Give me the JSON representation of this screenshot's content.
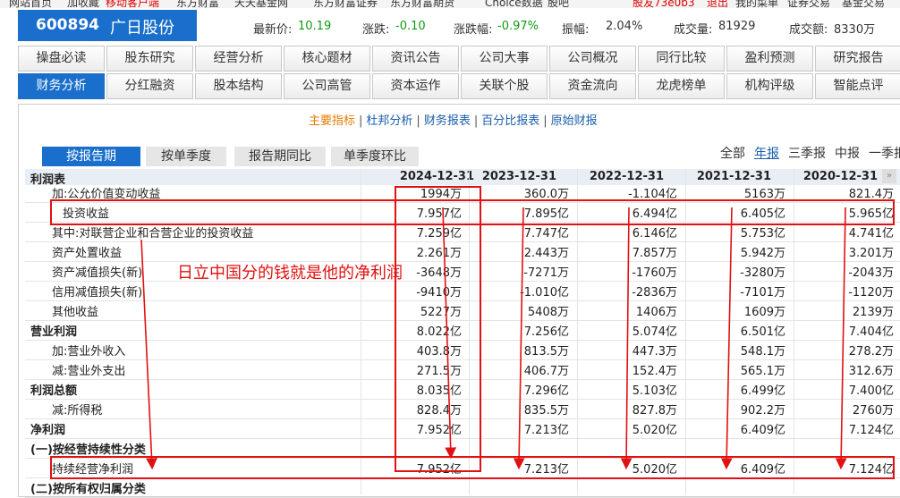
{
  "top_nav": {
    "items": [
      {
        "label": "网站首页",
        "red": false
      },
      {
        "label": "加收藏",
        "red": false
      },
      {
        "label": "移动客户端",
        "red": true
      },
      {
        "label": "东方财富",
        "red": false
      },
      {
        "label": "天天基金网",
        "red": false
      },
      {
        "label": "东方财富证券",
        "red": false
      },
      {
        "label": "东方财富期货",
        "red": false
      },
      {
        "label": "Choice数据",
        "red": false
      },
      {
        "label": "股吧",
        "red": false
      },
      {
        "label": "股友73e0b3",
        "red": true
      },
      {
        "label": "退出",
        "red": true
      },
      {
        "label": "我的菜单",
        "red": false
      },
      {
        "label": "证券交易",
        "red": false
      },
      {
        "label": "基金交易",
        "red": false
      }
    ]
  },
  "stock": {
    "code": "600894",
    "name": "广日股份"
  },
  "quote": {
    "price_label": "最新价:",
    "price": "10.19",
    "change_label": "涨跌:",
    "change": "-0.10",
    "change_pct_label": "涨跌幅:",
    "change_pct": "-0.97%",
    "amplitude_label": "振幅:",
    "amplitude": "2.04%",
    "volume_label": "成交量:",
    "volume": "81929",
    "turnover_label": "成交额:",
    "turnover": "8330万"
  },
  "tabs_row1": [
    "操盘必读",
    "股东研究",
    "经营分析",
    "核心题材",
    "资讯公告",
    "公司大事",
    "公司概况",
    "同行比较",
    "盈利预测",
    "研究报告"
  ],
  "tabs_row2": [
    "财务分析",
    "分红融资",
    "股本结构",
    "公司高管",
    "资本运作",
    "关联个股",
    "资金流向",
    "龙虎榜单",
    "机构评级",
    "智能点评"
  ],
  "active_tab": "财务分析",
  "sub_links": [
    "主要指标",
    "杜邦分析",
    "财务报表",
    "百分比报表",
    "原始财报"
  ],
  "active_sub_link": "主要指标",
  "period_tabs": [
    "按报告期",
    "按单季度",
    "报告期同比",
    "单季度环比"
  ],
  "period_filters": [
    "全部",
    "年报",
    "三季报",
    "中报",
    "一季报"
  ],
  "active_filter": "年报",
  "table": {
    "title": "利润表",
    "columns": [
      "2024-12-31",
      "2023-12-31",
      "2022-12-31",
      "2021-12-31",
      "2020-12-31"
    ],
    "rows": [
      {
        "label": "加:公允价值变动收益",
        "indent": 2,
        "bold": false,
        "values": [
          "1994万",
          "360.0万",
          "-1.104亿",
          "5163万",
          "821.4万"
        ]
      },
      {
        "label": "投资收益",
        "indent": 3,
        "bold": false,
        "values": [
          "7.957亿",
          "7.895亿",
          "6.494亿",
          "6.405亿",
          "5.965亿"
        ]
      },
      {
        "label": "其中:对联营企业和合营企业的投资收益",
        "indent": 2,
        "bold": false,
        "values": [
          "7.259亿",
          "7.747亿",
          "6.146亿",
          "5.753亿",
          "4.741亿"
        ]
      },
      {
        "label": "资产处置收益",
        "indent": 2,
        "bold": false,
        "values": [
          "2.261万",
          "2.443万",
          "7.857万",
          "5.942万",
          "3.201万"
        ]
      },
      {
        "label": "资产减值损失(新)",
        "indent": 2,
        "bold": false,
        "values": [
          "-3648万",
          "-7271万",
          "-1760万",
          "-3280万",
          "-2043万"
        ]
      },
      {
        "label": "信用减值损失(新)",
        "indent": 2,
        "bold": false,
        "values": [
          "-9410万",
          "-1.010亿",
          "-2836万",
          "-7101万",
          "-1120万"
        ]
      },
      {
        "label": "其他收益",
        "indent": 2,
        "bold": false,
        "values": [
          "5227万",
          "5408万",
          "1406万",
          "1609万",
          "2139万"
        ]
      },
      {
        "label": "营业利润",
        "indent": 0,
        "bold": true,
        "values": [
          "8.022亿",
          "7.256亿",
          "5.074亿",
          "6.501亿",
          "7.404亿"
        ]
      },
      {
        "label": "加:营业外收入",
        "indent": 2,
        "bold": false,
        "values": [
          "403.8万",
          "813.5万",
          "447.3万",
          "548.1万",
          "278.2万"
        ]
      },
      {
        "label": "减:营业外支出",
        "indent": 2,
        "bold": false,
        "values": [
          "271.5万",
          "406.7万",
          "152.4万",
          "565.1万",
          "312.6万"
        ]
      },
      {
        "label": "利润总额",
        "indent": 0,
        "bold": true,
        "values": [
          "8.035亿",
          "7.296亿",
          "5.103亿",
          "6.499亿",
          "7.400亿"
        ]
      },
      {
        "label": "减:所得税",
        "indent": 2,
        "bold": false,
        "values": [
          "828.4万",
          "835.5万",
          "827.8万",
          "902.2万",
          "2760万"
        ]
      },
      {
        "label": "净利润",
        "indent": 0,
        "bold": true,
        "values": [
          "7.952亿",
          "7.213亿",
          "5.020亿",
          "6.409亿",
          "7.124亿"
        ]
      },
      {
        "label": "(一)按经营持续性分类",
        "indent": 0,
        "bold": true,
        "values": [
          "",
          "",
          "",
          "",
          ""
        ]
      },
      {
        "label": "持续经营净利润",
        "indent": 2,
        "bold": false,
        "values": [
          "7.952亿",
          "7.213亿",
          "5.020亿",
          "6.409亿",
          "7.124亿"
        ]
      },
      {
        "label": "(二)按所有权归属分类",
        "indent": 0,
        "bold": true,
        "values": [
          "",
          "",
          "",
          "",
          ""
        ]
      }
    ]
  },
  "annotation": "日立中国分的钱就是他的净利润",
  "colors": {
    "accent": "#1a6fcc",
    "annotation_red": "#e21010",
    "green": "#129a12",
    "link": "#1a5eab",
    "active_link": "#e87a00"
  }
}
